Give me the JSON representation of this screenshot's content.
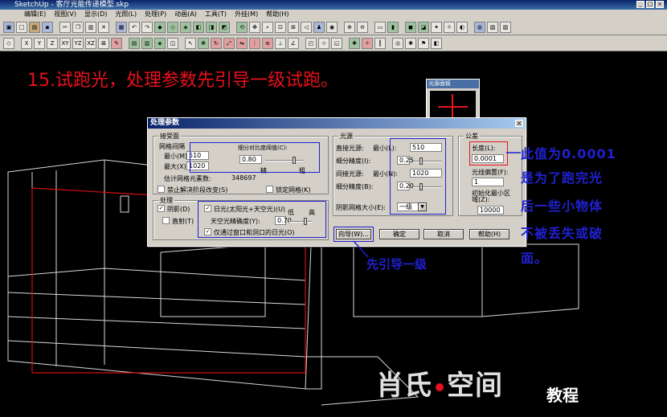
{
  "window": {
    "title": "SketchUp - 客厅光能传递模型.skp"
  },
  "menu": [
    "编辑(E)",
    "视图(V)",
    "显示(D)",
    "光照(L)",
    "处理(P)",
    "动画(A)",
    "工具(T)",
    "外挂(M)",
    "帮助(H)"
  ],
  "toolbar2_axes": [
    "X",
    "Y",
    "Z",
    "XY",
    "YZ",
    "XZ"
  ],
  "heading": "15.试跑光，处理参数先引导一级试跑。",
  "small_window": {
    "title": "光源面板"
  },
  "dialog": {
    "title": "处理参数",
    "close": "×",
    "receiver_group": "接受面",
    "mesh_spacing": "网格间隔",
    "min_label": "最小(M):",
    "min_value": "510",
    "max_label": "最大(X):",
    "max_value": "1020",
    "subdivision_contrast": "细分对比度阈值(C):",
    "contrast_value": "0.80",
    "fine": "精",
    "coarse": "粗",
    "estimate_label": "估计网格元素数:",
    "estimate_value": "348697",
    "disable_resolve": "禁止解决阶段改变(S)",
    "lock_mesh": "锁定网格(K)",
    "process_group": "处理",
    "shadow": "阴影(D)",
    "direct": "直射(T)",
    "daylight": "日光(太阳光+天空光)(U)",
    "sky_precision": "天空光精确度(Y):",
    "sky_value": "0.70",
    "low": "低",
    "high": "高",
    "windows_only": "仅通过窗口和洞口的日光(O)",
    "lightsource_group": "光源",
    "direct_light": "直接光源:",
    "direct_min_label": "最小(L):",
    "direct_min_value": "510",
    "sub_precision1": "细分精度(I):",
    "sub_value1": "0.25",
    "indirect_light": "间接光源:",
    "indirect_min_label": "最小(N):",
    "indirect_min_value": "1020",
    "sub_precision2": "细分精度(B):",
    "sub_value2": "0.20",
    "shadow_mesh_size": "阴影网格大小(E):",
    "shadow_mesh_value": "一级",
    "tolerance_group": "公差",
    "length_label": "长度(L):",
    "length_value": "0.0001",
    "light_offset": "光线偏置(F):",
    "light_offset_value": "1",
    "init_min_area": "初始化最小区域(Z):",
    "init_min_area_value": "10000",
    "guide_button": "向导(W)...",
    "ok_button": "确定",
    "cancel_button": "取消",
    "help_button": "帮助(H)"
  },
  "annotations": {
    "length_note": [
      "此值为0.0001",
      "是为了跑完光",
      "后一些小物体",
      "不被丢失或破",
      "面。"
    ],
    "guide_note": "先引导一级"
  },
  "logo": {
    "main_left": "肖氏",
    "main_right": "空间",
    "sub": "教程"
  },
  "colors": {
    "heading": "#e8111c",
    "annotation": "#2020d0"
  }
}
